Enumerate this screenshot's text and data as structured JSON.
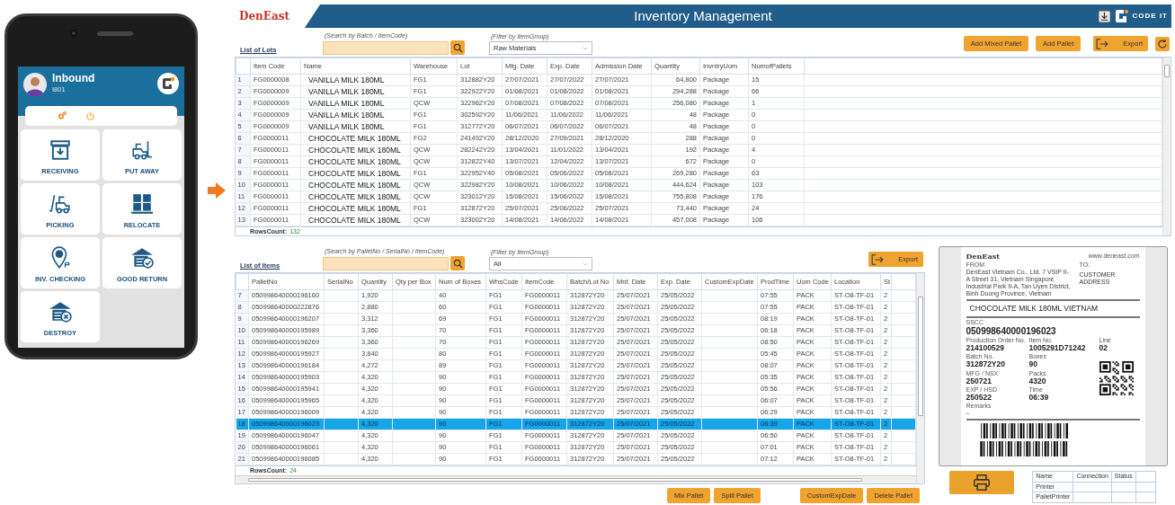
{
  "phone": {
    "title": "Inbound",
    "subtitle": "I801",
    "tiles": [
      "RECEIVING",
      "PUT AWAY",
      "PICKING",
      "RELOCATE",
      "INV. CHECKING",
      "GOOD RETURN",
      "DESTROY"
    ]
  },
  "app": {
    "brand": "DenEast",
    "title": "Inventory Management",
    "vendor": "CODE IT"
  },
  "lots": {
    "heading": "List of Lots",
    "search_label": "(Search by Batch / ItemCode)",
    "filter_label": "(Filter by ItemGroup)",
    "filter_value": "Raw Materials",
    "buttons": [
      "Add Mixed Pallet",
      "Add Pallet"
    ],
    "export": "Export",
    "columns": [
      "",
      "Item Code",
      "Name",
      "Warehouse",
      "Lot",
      "Mfg. Date",
      "Exp. Date",
      "Admission Date",
      "Quantity",
      "InvntryUom",
      "NumofPallets"
    ],
    "rows": [
      [
        "1",
        "FG0000008",
        "VANILLA MILK 180ML",
        "FG1",
        "312882Y20",
        "27/07/2021",
        "27/07/2022",
        "27/07/2021",
        "64,800",
        "Package",
        "15"
      ],
      [
        "2",
        "FG0000009",
        "VANILLA MILK 180ML",
        "FG1",
        "322922Y20",
        "01/08/2021",
        "01/08/2022",
        "01/08/2021",
        "294,288",
        "Package",
        "66"
      ],
      [
        "3",
        "FG0000009",
        "VANILLA MILK 180ML",
        "QCW",
        "322962Y20",
        "07/08/2021",
        "07/08/2022",
        "07/08/2021",
        "256,080",
        "Package",
        "1"
      ],
      [
        "4",
        "FG0000009",
        "VANILLA MILK 180ML",
        "FG1",
        "302592Y20",
        "11/06/2021",
        "11/06/2022",
        "11/06/2021",
        "48",
        "Package",
        "0"
      ],
      [
        "5",
        "FG0000009",
        "VANILLA MILK 180ML",
        "FG1",
        "312772Y20",
        "06/07/2021",
        "06/07/2022",
        "06/07/2021",
        "48",
        "Package",
        "0"
      ],
      [
        "6",
        "FG0000011",
        "CHOCOLATE MILK 180ML",
        "FG2",
        "241492Y20",
        "28/12/2020",
        "27/09/2021",
        "28/12/2020",
        "288",
        "Package",
        "0"
      ],
      [
        "7",
        "FG0000011",
        "CHOCOLATE MILK 180ML",
        "QCW",
        "282242Y20",
        "13/04/2021",
        "11/01/2022",
        "13/04/2021",
        "192",
        "Package",
        "4"
      ],
      [
        "8",
        "FG0000011",
        "CHOCOLATE MILK 180ML",
        "QCW",
        "312822Y40",
        "13/07/2021",
        "12/04/2022",
        "13/07/2021",
        "672",
        "Package",
        "0"
      ],
      [
        "9",
        "FG0000011",
        "CHOCOLATE MILK 180ML",
        "FG1",
        "322952Y40",
        "05/08/2021",
        "05/06/2022",
        "05/08/2021",
        "269,280",
        "Package",
        "63"
      ],
      [
        "10",
        "FG0000011",
        "CHOCOLATE MILK 180ML",
        "QCW",
        "322982Y20",
        "10/08/2021",
        "10/06/2022",
        "10/08/2021",
        "444,624",
        "Package",
        "103"
      ],
      [
        "11",
        "FG0000011",
        "CHOCOLATE MILK 180ML",
        "QCW",
        "323012Y20",
        "15/08/2021",
        "15/06/2022",
        "15/08/2021",
        "755,808",
        "Package",
        "176"
      ],
      [
        "12",
        "FG0000011",
        "CHOCOLATE MILK 180ML",
        "FG1",
        "312872Y20",
        "25/07/2021",
        "25/06/2022",
        "25/07/2021",
        "73,440",
        "Package",
        "24"
      ],
      [
        "13",
        "FG0000011",
        "CHOCOLATE MILK 180ML",
        "QCW",
        "323002Y20",
        "14/08/2021",
        "14/06/2022",
        "14/08/2021",
        "457,008",
        "Package",
        "106"
      ]
    ],
    "rows_count_label": "RowsCount:",
    "rows_count": "132"
  },
  "items": {
    "heading": "List of Items",
    "search_label": "(Search by PalletNo / SerialNo / ItemCode)",
    "filter_label": "(Filter by ItemGroup)",
    "filter_value": "All",
    "export": "Export",
    "columns": [
      "",
      "PalletNo",
      "SerialNo",
      "Quantity",
      "Qty per Box",
      "Num of Boxes",
      "WhsCode",
      "ItemCode",
      "Batch/Lot No",
      "Mnf. Date",
      "Exp. Date",
      "CustomExpDate",
      "ProdTime",
      "Uom Code",
      "Location",
      "St"
    ],
    "rows": [
      {
        "cells": [
          "7",
          "050998640000196160",
          "",
          "1,920",
          "",
          "40",
          "FG1",
          "FG0000011",
          "312872Y20",
          "25/07/2021",
          "25/05/2022",
          "",
          "07:55",
          "PACK",
          "ST-O8-TF-01",
          "2"
        ],
        "selected": false
      },
      {
        "cells": [
          "8",
          "050998640000222876",
          "",
          "2,880",
          "",
          "60",
          "FG1",
          "FG0000011",
          "312872Y20",
          "25/07/2021",
          "25/05/2022",
          "",
          "07:55",
          "PACK",
          "ST-O8-TF-01",
          "2"
        ],
        "selected": false
      },
      {
        "cells": [
          "9",
          "050998640000196207",
          "",
          "3,312",
          "",
          "69",
          "FG1",
          "FG0000011",
          "312872Y20",
          "25/07/2021",
          "25/05/2022",
          "",
          "08:19",
          "PACK",
          "ST-O8-TF-01",
          "2"
        ],
        "selected": false
      },
      {
        "cells": [
          "10",
          "050998640000195989",
          "",
          "3,360",
          "",
          "70",
          "FG1",
          "FG0000011",
          "312872Y20",
          "25/07/2021",
          "25/05/2022",
          "",
          "06:18",
          "PACK",
          "ST-O8-TF-01",
          "2"
        ],
        "selected": false
      },
      {
        "cells": [
          "11",
          "050998640000196269",
          "",
          "3,360",
          "",
          "70",
          "FG1",
          "FG0000011",
          "312872Y20",
          "25/07/2021",
          "25/05/2022",
          "",
          "08:50",
          "PACK",
          "ST-O8-TF-01",
          "2"
        ],
        "selected": false
      },
      {
        "cells": [
          "12",
          "050998640000195927",
          "",
          "3,840",
          "",
          "80",
          "FG1",
          "FG0000011",
          "312872Y20",
          "25/07/2021",
          "25/05/2022",
          "",
          "05:45",
          "PACK",
          "ST-O8-TF-01",
          "2"
        ],
        "selected": false
      },
      {
        "cells": [
          "13",
          "050998640000196184",
          "",
          "4,272",
          "",
          "89",
          "FG1",
          "FG0000011",
          "312872Y20",
          "25/07/2021",
          "25/05/2022",
          "",
          "08:07",
          "PACK",
          "ST-O8-TF-01",
          "2"
        ],
        "selected": false
      },
      {
        "cells": [
          "14",
          "050998640000195903",
          "",
          "4,320",
          "",
          "90",
          "FG1",
          "FG0000011",
          "312872Y20",
          "25/07/2021",
          "25/05/2022",
          "",
          "05:35",
          "PACK",
          "ST-O8-TF-01",
          "2"
        ],
        "selected": false
      },
      {
        "cells": [
          "15",
          "050998640000195941",
          "",
          "4,320",
          "",
          "90",
          "FG1",
          "FG0000011",
          "312872Y20",
          "25/07/2021",
          "25/05/2022",
          "",
          "05:56",
          "PACK",
          "ST-O8-TF-01",
          "2"
        ],
        "selected": false
      },
      {
        "cells": [
          "16",
          "050998640000195965",
          "",
          "4,320",
          "",
          "90",
          "FG1",
          "FG0000011",
          "312872Y20",
          "25/07/2021",
          "25/05/2022",
          "",
          "06:07",
          "PACK",
          "ST-O8-TF-01",
          "2"
        ],
        "selected": false
      },
      {
        "cells": [
          "17",
          "050998640000196009",
          "",
          "4,320",
          "",
          "90",
          "FG1",
          "FG0000011",
          "312872Y20",
          "25/07/2021",
          "25/05/2022",
          "",
          "06:29",
          "PACK",
          "ST-O8-TF-01",
          "2"
        ],
        "selected": false
      },
      {
        "cells": [
          "18",
          "050998640000196023",
          "",
          "4,320",
          "",
          "90",
          "FG1",
          "FG0000011",
          "312872Y20",
          "25/07/2021",
          "25/05/2022",
          "",
          "06:39",
          "PACK",
          "ST-O8-TF-01",
          "2"
        ],
        "selected": true
      },
      {
        "cells": [
          "19",
          "050998640000196047",
          "",
          "4,320",
          "",
          "90",
          "FG1",
          "FG0000011",
          "312872Y20",
          "25/07/2021",
          "25/05/2022",
          "",
          "06:50",
          "PACK",
          "ST-O8-TF-01",
          "2"
        ],
        "selected": false
      },
      {
        "cells": [
          "20",
          "050998640000196061",
          "",
          "4,320",
          "",
          "90",
          "FG1",
          "FG0000011",
          "312872Y20",
          "25/07/2021",
          "25/05/2022",
          "",
          "07:01",
          "PACK",
          "ST-O8-TF-01",
          "2"
        ],
        "selected": false
      },
      {
        "cells": [
          "21",
          "050998640000196085",
          "",
          "4,320",
          "",
          "90",
          "FG1",
          "FG0000011",
          "312872Y20",
          "25/07/2021",
          "25/05/2022",
          "",
          "07:12",
          "PACK",
          "ST-O8-TF-01",
          "2"
        ],
        "selected": false
      }
    ],
    "rows_count_label": "RowsCount:",
    "rows_count": "24",
    "buttons": [
      "Mix Pallet",
      "Split Pallet",
      "CustomExpDate",
      "Delete Pallet"
    ]
  },
  "label": {
    "brand": "DenEast",
    "website": "www.deneast.com",
    "from_label": "FROM",
    "from_address": "DenEast Vietnam Co., Ltd. 7 VSIP II-A Street 31, Vietnam Singapore Industrial Park II-A, Tan Uyen District, Binh Duong Province, Vietnam",
    "to_label": "TO:",
    "to_address": "CUSTOMER ADDRESS",
    "product": "CHOCOLATE MILK 180ML VIETNAM",
    "sscc_label": "SSCC",
    "sscc": "050998640000196023",
    "fields": [
      {
        "label": "Production Order No.",
        "value": "214100529"
      },
      {
        "label": "Item No.",
        "value": "1005291D71242"
      },
      {
        "label": "Line",
        "value": "02"
      },
      {
        "label": "Batch No.",
        "value": "312872Y20"
      },
      {
        "label": "Boxes",
        "value": "90"
      },
      {
        "label": "MFG / NSX",
        "value": "250721"
      },
      {
        "label": "Packs",
        "value": "4320"
      },
      {
        "label": "EXP / HSD",
        "value": "250522"
      },
      {
        "label": "Time",
        "value": "06:39"
      }
    ],
    "remarks_label": "Remarks",
    "remarks": "–"
  },
  "printers": {
    "columns": [
      "Name",
      "Connection",
      "Status",
      ""
    ],
    "rows": [
      [
        "Printer",
        "",
        "",
        ""
      ],
      [
        "PalletPrinter",
        "",
        "",
        ""
      ]
    ]
  }
}
